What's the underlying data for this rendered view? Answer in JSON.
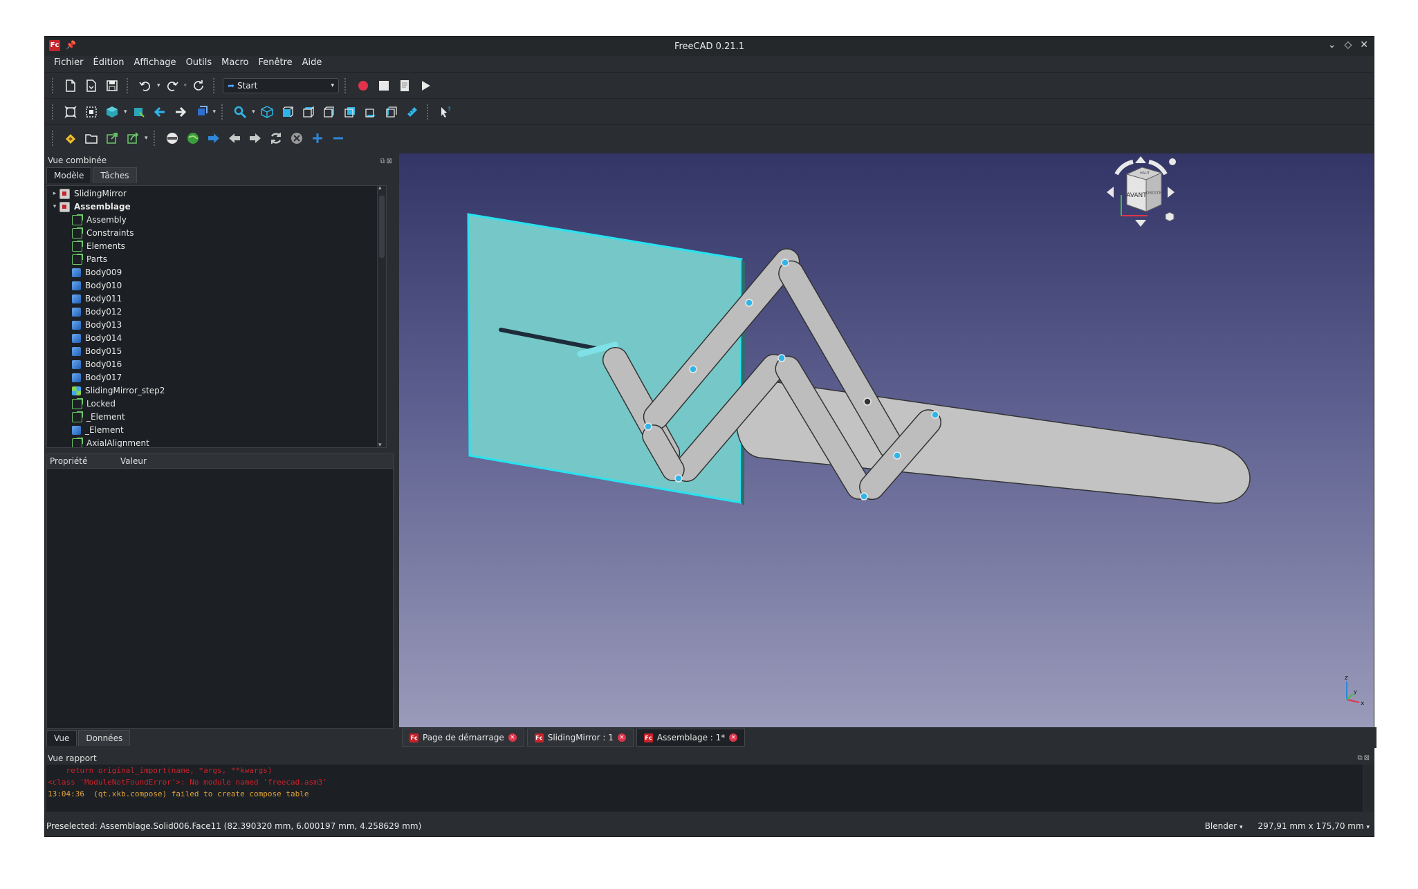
{
  "window": {
    "title": "FreeCAD 0.21.1",
    "controls": [
      "⌄",
      "◇",
      "✕"
    ]
  },
  "menu": [
    "Fichier",
    "Édition",
    "Affichage",
    "Outils",
    "Macro",
    "Fenêtre",
    "Aide"
  ],
  "toolbar": {
    "workbench": "Start"
  },
  "left_panel": {
    "title": "Vue combinée",
    "tabs": [
      "Modèle",
      "Tâches"
    ],
    "tree": [
      {
        "label": "SlidingMirror",
        "level": 0,
        "icon": "document-icon",
        "arrow": "▸",
        "bold": false
      },
      {
        "label": "Assemblage",
        "level": 0,
        "icon": "document-icon",
        "arrow": "▾",
        "bold": true
      },
      {
        "label": "Assembly",
        "level": 1,
        "icon": "link-icon"
      },
      {
        "label": "Constraints",
        "level": 1,
        "icon": "link-icon"
      },
      {
        "label": "Elements",
        "level": 1,
        "icon": "link-icon"
      },
      {
        "label": "Parts",
        "level": 1,
        "icon": "link-icon"
      },
      {
        "label": "Body009",
        "level": 1,
        "icon": "body-icon"
      },
      {
        "label": "Body010",
        "level": 1,
        "icon": "body-icon"
      },
      {
        "label": "Body011",
        "level": 1,
        "icon": "body-icon"
      },
      {
        "label": "Body012",
        "level": 1,
        "icon": "body-icon"
      },
      {
        "label": "Body013",
        "level": 1,
        "icon": "body-icon"
      },
      {
        "label": "Body014",
        "level": 1,
        "icon": "body-icon"
      },
      {
        "label": "Body015",
        "level": 1,
        "icon": "body-icon"
      },
      {
        "label": "Body016",
        "level": 1,
        "icon": "body-icon"
      },
      {
        "label": "Body017",
        "level": 1,
        "icon": "body-icon"
      },
      {
        "label": "SlidingMirror_step2",
        "level": 1,
        "icon": "step-icon"
      },
      {
        "label": "Locked",
        "level": 1,
        "icon": "link-icon"
      },
      {
        "label": "_Element",
        "level": 1,
        "icon": "link-icon"
      },
      {
        "label": "_Element",
        "level": 1,
        "icon": "body-icon"
      },
      {
        "label": "AxialAlignment",
        "level": 1,
        "icon": "link-icon"
      }
    ],
    "properties": {
      "col_property": "Propriété",
      "col_value": "Valeur"
    },
    "bottom_tabs": [
      "Vue",
      "Données"
    ]
  },
  "navcube": {
    "front": "AVANT",
    "right": "DROITE",
    "top": "HAUT"
  },
  "axes": {
    "x": "x",
    "y": "y",
    "z": "z"
  },
  "doc_tabs": [
    {
      "label": "Page de démarrage",
      "active": false
    },
    {
      "label": "SlidingMirror : 1",
      "active": false
    },
    {
      "label": "Assemblage : 1*",
      "active": true
    }
  ],
  "report": {
    "title": "Vue rapport",
    "lines": [
      {
        "text": "    return original_import(name, *args, **kwargs)",
        "color": "red"
      },
      {
        "text": "<class 'ModuleNotFoundError'>: No module named 'freecad.asm3'",
        "color": "red"
      },
      {
        "text": "13:04:36  (qt.xkb.compose) failed to create compose table",
        "color": "orange"
      }
    ]
  },
  "status": {
    "preselected": "Preselected: Assemblage.Solid006.Face11 (82.390320 mm, 6.000197 mm, 4.258629 mm)",
    "nav_style": "Blender",
    "dimensions": "297,91 mm x 175,70 mm"
  },
  "colors": {
    "mirror": "#76c8c8",
    "mirror_edge": "#27e3f0",
    "links": "#bdbdbd",
    "accent": "#2fb6e8"
  }
}
